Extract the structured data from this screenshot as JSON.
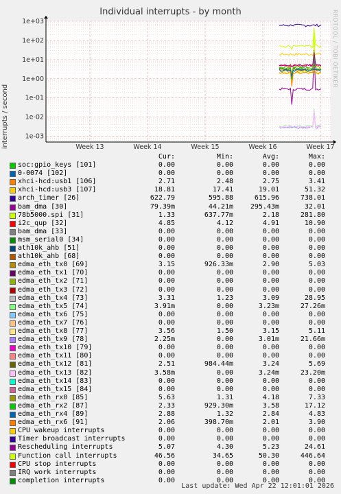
{
  "title": "Individual interrupts - by month",
  "ylabel": "interrupts / second",
  "watermark": "RRDTOOL / TOBI OETIKER",
  "columns": [
    "Cur:",
    "Min:",
    "Avg:",
    "Max:"
  ],
  "footer": "Last update: Wed Apr 22 12:01:01 2026",
  "chart_data": {
    "type": "line",
    "y_scale": "log",
    "ylim": [
      0.0005,
      1000
    ],
    "y_ticks": [
      "1e+03",
      "1e+02",
      "1e+01",
      "1e+00",
      "1e-01",
      "1e-02",
      "1e-03"
    ],
    "x_ticks": [
      "Week 13",
      "Week 14",
      "Week 15",
      "Week 16",
      "Week 17"
    ],
    "grid": true,
    "series": [
      {
        "name": "soc:gpio_keys [101]",
        "color": "#00cc00",
        "cur": "0.00",
        "min": "0.00",
        "avg": "0.00",
        "max": "0.00"
      },
      {
        "name": "0-0074 [102]",
        "color": "#0066b3",
        "cur": "0.00",
        "min": "0.00",
        "avg": "0.00",
        "max": "0.00"
      },
      {
        "name": "xhci-hcd:usb1 [106]",
        "color": "#ff8000",
        "cur": "2.71",
        "min": "2.48",
        "avg": "2.75",
        "max": "3.41"
      },
      {
        "name": "xhci-hcd:usb3 [107]",
        "color": "#ffcc00",
        "cur": "18.81",
        "min": "17.41",
        "avg": "19.01",
        "max": "51.32"
      },
      {
        "name": "arch_timer [26]",
        "color": "#330099",
        "cur": "622.79",
        "min": "595.88",
        "avg": "615.96",
        "max": "738.01"
      },
      {
        "name": "bam_dma [30]",
        "color": "#990099",
        "cur": "79.39m",
        "min": "44.21m",
        "avg": "295.43m",
        "max": "32.01"
      },
      {
        "name": "78b5000.spi [31]",
        "color": "#ccff00",
        "cur": "1.33",
        "min": "637.77m",
        "avg": "2.18",
        "max": "281.80"
      },
      {
        "name": "i2c_qup [32]",
        "color": "#ff0000",
        "cur": "4.85",
        "min": "4.12",
        "avg": "4.91",
        "max": "10.90"
      },
      {
        "name": "bam_dma [33]",
        "color": "#808080",
        "cur": "0.00",
        "min": "0.00",
        "avg": "0.00",
        "max": "0.00"
      },
      {
        "name": "msm_serial0 [34]",
        "color": "#008f00",
        "cur": "0.00",
        "min": "0.00",
        "avg": "0.00",
        "max": "0.00"
      },
      {
        "name": "ath10k_ahb [51]",
        "color": "#00487d",
        "cur": "0.00",
        "min": "0.00",
        "avg": "0.00",
        "max": "0.00"
      },
      {
        "name": "ath10k_ahb [68]",
        "color": "#b35a00",
        "cur": "0.00",
        "min": "0.00",
        "avg": "0.00",
        "max": "0.00"
      },
      {
        "name": "edma_eth_tx0 [69]",
        "color": "#b38f00",
        "cur": "3.15",
        "min": "926.33m",
        "avg": "2.90",
        "max": "5.03"
      },
      {
        "name": "edma_eth_tx1 [70]",
        "color": "#6b006b",
        "cur": "0.00",
        "min": "0.00",
        "avg": "0.00",
        "max": "0.00"
      },
      {
        "name": "edma_eth_tx2 [71]",
        "color": "#8fb300",
        "cur": "0.00",
        "min": "0.00",
        "avg": "0.00",
        "max": "0.00"
      },
      {
        "name": "edma_eth_tx3 [72]",
        "color": "#b30000",
        "cur": "0.00",
        "min": "0.00",
        "avg": "0.00",
        "max": "0.00"
      },
      {
        "name": "edma_eth_tx4 [73]",
        "color": "#bebebe",
        "cur": "3.31",
        "min": "1.23",
        "avg": "3.09",
        "max": "28.95"
      },
      {
        "name": "edma_eth_tx5 [74]",
        "color": "#80ff80",
        "cur": "3.91m",
        "min": "0.00",
        "avg": "3.23m",
        "max": "27.26m"
      },
      {
        "name": "edma_eth_tx6 [75]",
        "color": "#80c9ff",
        "cur": "0.00",
        "min": "0.00",
        "avg": "0.00",
        "max": "0.00"
      },
      {
        "name": "edma_eth_tx7 [76]",
        "color": "#ffc080",
        "cur": "0.00",
        "min": "0.00",
        "avg": "0.00",
        "max": "0.00"
      },
      {
        "name": "edma_eth_tx8 [77]",
        "color": "#ffe680",
        "cur": "3.56",
        "min": "1.50",
        "avg": "3.15",
        "max": "5.11"
      },
      {
        "name": "edma_eth_tx9 [78]",
        "color": "#aa80ff",
        "cur": "2.25m",
        "min": "0.00",
        "avg": "3.01m",
        "max": "21.66m"
      },
      {
        "name": "edma_eth_tx10 [79]",
        "color": "#ee00cc",
        "cur": "0.00",
        "min": "0.00",
        "avg": "0.00",
        "max": "0.00"
      },
      {
        "name": "edma_eth_tx11 [80]",
        "color": "#ff8080",
        "cur": "0.00",
        "min": "0.00",
        "avg": "0.00",
        "max": "0.00"
      },
      {
        "name": "edma_eth_tx12 [81]",
        "color": "#666600",
        "cur": "2.51",
        "min": "984.44m",
        "avg": "3.24",
        "max": "5.69"
      },
      {
        "name": "edma_eth_tx13 [82]",
        "color": "#ffbfff",
        "cur": "3.58m",
        "min": "0.00",
        "avg": "3.24m",
        "max": "23.20m"
      },
      {
        "name": "edma_eth_tx14 [83]",
        "color": "#00ffcc",
        "cur": "0.00",
        "min": "0.00",
        "avg": "0.00",
        "max": "0.00"
      },
      {
        "name": "edma_eth_tx15 [84]",
        "color": "#cc6699",
        "cur": "0.00",
        "min": "0.00",
        "avg": "0.00",
        "max": "0.00"
      },
      {
        "name": "edma_eth_rx0 [85]",
        "color": "#999900",
        "cur": "5.63",
        "min": "1.31",
        "avg": "4.18",
        "max": "7.33"
      },
      {
        "name": "edma_eth_rx2 [87]",
        "color": "#00cc00",
        "cur": "2.33",
        "min": "929.30m",
        "avg": "3.58",
        "max": "17.12"
      },
      {
        "name": "edma_eth_rx4 [89]",
        "color": "#0066b3",
        "cur": "2.88",
        "min": "1.32",
        "avg": "2.84",
        "max": "4.83"
      },
      {
        "name": "edma_eth_rx6 [91]",
        "color": "#ff8000",
        "cur": "2.06",
        "min": "398.70m",
        "avg": "2.01",
        "max": "3.90"
      },
      {
        "name": "CPU wakeup interrupts",
        "color": "#ffcc00",
        "cur": "0.00",
        "min": "0.00",
        "avg": "0.00",
        "max": "0.00"
      },
      {
        "name": "Timer broadcast interrupts",
        "color": "#330099",
        "cur": "0.00",
        "min": "0.00",
        "avg": "0.00",
        "max": "0.00"
      },
      {
        "name": "Rescheduling interrupts",
        "color": "#990099",
        "cur": "5.07",
        "min": "4.30",
        "avg": "5.23",
        "max": "24.61"
      },
      {
        "name": "Function call interrupts",
        "color": "#ccff00",
        "cur": "46.56",
        "min": "34.65",
        "avg": "50.30",
        "max": "446.64"
      },
      {
        "name": "CPU stop interrupts",
        "color": "#ff0000",
        "cur": "0.00",
        "min": "0.00",
        "avg": "0.00",
        "max": "0.00"
      },
      {
        "name": "IRQ work interrupts",
        "color": "#808080",
        "cur": "0.00",
        "min": "0.00",
        "avg": "0.00",
        "max": "0.00"
      },
      {
        "name": "completion interrupts",
        "color": "#008f00",
        "cur": "0.00",
        "min": "0.00",
        "avg": "0.00",
        "max": "0.00"
      }
    ]
  }
}
